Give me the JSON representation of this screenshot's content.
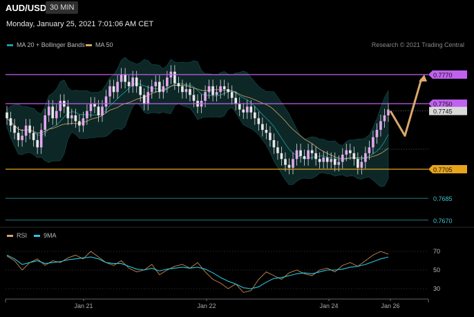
{
  "header": {
    "symbol": "AUD/USD",
    "timeframe": "30 MIN",
    "timestamp": "Monday, January 25, 2021 7:01:06 AM CET"
  },
  "legend": {
    "main": [
      {
        "label": "MA 20 + Bollinger Bands",
        "color": "#1f9e9e"
      },
      {
        "label": "MA 50",
        "color": "#d9a86c"
      }
    ],
    "rsi": [
      {
        "label": "RSI",
        "color": "#d9a86c"
      },
      {
        "label": "9MA",
        "color": "#29c9e0"
      }
    ],
    "copyright": "Research © 2021 Trading Central"
  },
  "chart_data": {
    "type": "candlestick",
    "price_range": [
      0.7663,
      0.7784
    ],
    "levels": [
      {
        "value": 0.777,
        "label": "0.7770",
        "kind": "resistance",
        "color": "#c161f0"
      },
      {
        "value": 0.775,
        "label": "0.7750",
        "kind": "resistance",
        "color": "#c161f0"
      },
      {
        "value": 0.7745,
        "label": "0.7745",
        "kind": "last",
        "color": "#dddddd"
      },
      {
        "value": 0.7705,
        "label": "0.7705",
        "kind": "pivot",
        "color": "#e8a51b"
      },
      {
        "value": 0.7685,
        "label": "0.7685",
        "kind": "support",
        "color": "#2aa7b5"
      },
      {
        "value": 0.767,
        "label": "0.7670",
        "kind": "support",
        "color": "#2aa7b5"
      }
    ],
    "x_labels": [
      "Jan 21",
      "Jan 22",
      "Jan 24",
      "Jan 26"
    ],
    "candles_close": [
      0.774,
      0.7735,
      0.773,
      0.7725,
      0.7728,
      0.7735,
      0.773,
      0.7725,
      0.772,
      0.7732,
      0.7742,
      0.7748,
      0.774,
      0.7745,
      0.7752,
      0.7748,
      0.774,
      0.7742,
      0.7738,
      0.7735,
      0.774,
      0.7745,
      0.775,
      0.7748,
      0.7742,
      0.7748,
      0.7755,
      0.7762,
      0.7758,
      0.7765,
      0.777,
      0.7765,
      0.7762,
      0.7768,
      0.7762,
      0.7756,
      0.775,
      0.7758,
      0.7762,
      0.7765,
      0.7758,
      0.7762,
      0.7768,
      0.7772,
      0.7764,
      0.7762,
      0.7758,
      0.776,
      0.7756,
      0.7752,
      0.7748,
      0.7752,
      0.7758,
      0.7762,
      0.7756,
      0.7758,
      0.7762,
      0.776,
      0.7758,
      0.7754,
      0.775,
      0.7746,
      0.7744,
      0.7748,
      0.7744,
      0.774,
      0.7736,
      0.7732,
      0.773,
      0.7725,
      0.772,
      0.7716,
      0.7712,
      0.7708,
      0.7706,
      0.7712,
      0.7718,
      0.7714,
      0.7712,
      0.7718,
      0.7716,
      0.7712,
      0.771,
      0.7713,
      0.771,
      0.7712,
      0.7708,
      0.771,
      0.7715,
      0.7718,
      0.7716,
      0.7712,
      0.7706,
      0.771,
      0.7716,
      0.772,
      0.7727,
      0.7732,
      0.7738,
      0.7742,
      0.7746
    ],
    "projection": [
      0.7745,
      0.7728,
      0.777
    ],
    "rsi": {
      "levels": [
        70,
        50,
        30
      ],
      "range": [
        20,
        80
      ],
      "rsi_values": [
        65,
        60,
        50,
        58,
        62,
        55,
        60,
        58,
        63,
        66,
        62,
        70,
        64,
        58,
        55,
        60,
        52,
        48,
        50,
        56,
        45,
        50,
        54,
        56,
        52,
        58,
        48,
        40,
        36,
        30,
        35,
        26,
        28,
        40,
        48,
        44,
        40,
        47,
        50,
        46,
        44,
        50,
        52,
        48,
        55,
        58,
        54,
        60,
        66,
        70,
        67
      ],
      "ma_values": [
        66,
        62,
        56,
        58,
        60,
        57,
        58,
        59,
        61,
        62,
        63,
        64,
        62,
        58,
        57,
        57,
        54,
        51,
        50,
        52,
        49,
        51,
        52,
        53,
        52,
        53,
        51,
        47,
        42,
        38,
        35,
        31,
        30,
        32,
        37,
        41,
        42,
        44,
        46,
        47,
        46,
        48,
        50,
        50,
        51,
        53,
        54,
        56,
        59,
        62,
        64
      ]
    }
  }
}
